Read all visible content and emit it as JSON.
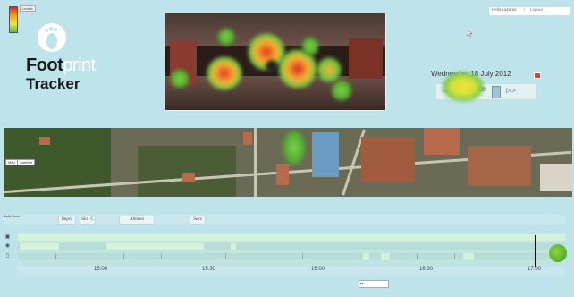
{
  "legend": {
    "label": "Levels"
  },
  "header": {
    "user": "Hello Lazarus",
    "sep": "|",
    "logout": "Logout"
  },
  "brand": {
    "foot": "Foot",
    "print": "print",
    "tracker": "Tracker"
  },
  "date": {
    "text": "Wednesday 18 July 2012"
  },
  "controls": {
    "prev": "◁◁",
    "value": "1500",
    "label": "30",
    "next": "▷▷"
  },
  "map": {
    "type_map": "Map",
    "type_satellite": "Satellite"
  },
  "filters": {
    "add_zone": "Add Zone",
    "chips": [
      "Impro",
      "Sin",
      "C",
      "Almeno",
      "Seve"
    ]
  },
  "timeline": {
    "labels": [
      "15:00",
      "15:30",
      "16:00",
      "16:30",
      "17:00"
    ],
    "scroll_label": "◂            ▸"
  },
  "colors": {
    "background": "#bfe3ea",
    "timeline_active": "#d4f2d9",
    "heat_hot": "#d62828",
    "heat_cool": "#57b947"
  }
}
